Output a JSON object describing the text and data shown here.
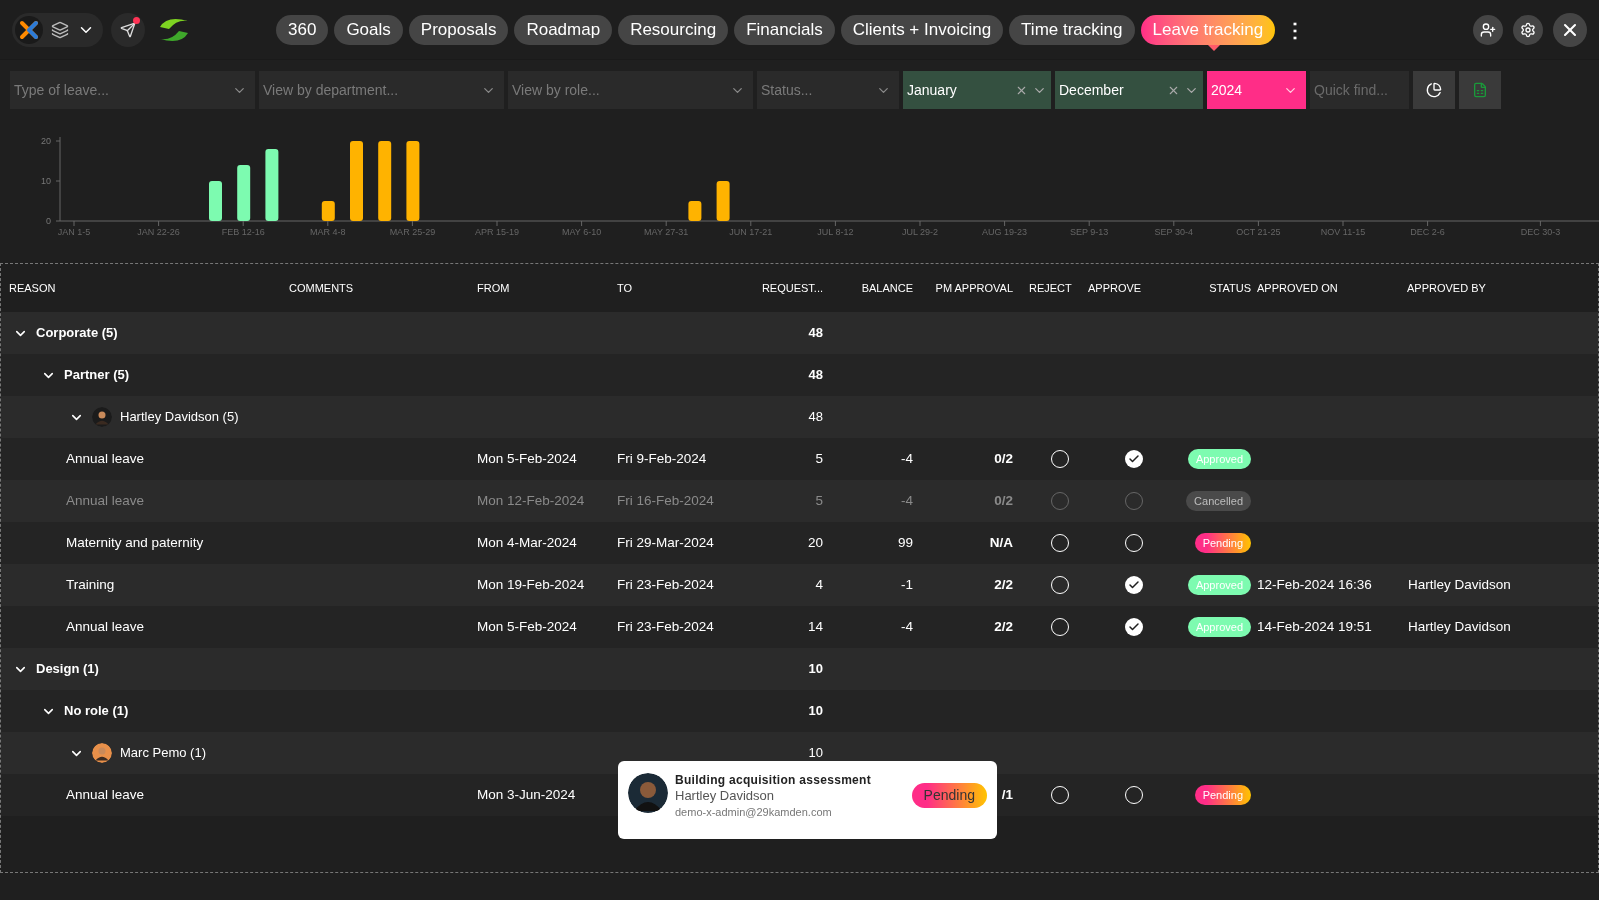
{
  "nav": {
    "tabs": [
      {
        "label": "360",
        "selected": false
      },
      {
        "label": "Goals",
        "selected": false
      },
      {
        "label": "Proposals",
        "selected": false
      },
      {
        "label": "Roadmap",
        "selected": false
      },
      {
        "label": "Resourcing",
        "selected": false
      },
      {
        "label": "Financials",
        "selected": false
      },
      {
        "label": "Clients + Invoicing",
        "selected": false
      },
      {
        "label": "Time tracking",
        "selected": false
      },
      {
        "label": "Leave tracking",
        "selected": true
      }
    ],
    "more": "⋮",
    "notification": true
  },
  "filters": [
    {
      "kind": "select",
      "placeholder": "Type of leave..."
    },
    {
      "kind": "select",
      "placeholder": "View by department..."
    },
    {
      "kind": "select",
      "placeholder": "View by role..."
    },
    {
      "kind": "select",
      "placeholder": "Status..."
    },
    {
      "kind": "range",
      "value": "January"
    },
    {
      "kind": "range",
      "value": "December"
    },
    {
      "kind": "year",
      "value": "2024"
    },
    {
      "kind": "search",
      "placeholder": "Quick find..."
    }
  ],
  "chart_data": {
    "type": "bar",
    "ylim": [
      0,
      20
    ],
    "yticks": [
      0,
      10,
      20
    ],
    "categories": [
      "JAN 1-5",
      null,
      null,
      "JAN 22-26",
      null,
      null,
      "FEB 12-16",
      null,
      null,
      "MAR 4-8",
      null,
      null,
      "MAR 25-29",
      null,
      null,
      "APR 15-19",
      null,
      null,
      "MAY 6-10",
      null,
      null,
      "MAY 27-31",
      null,
      null,
      "JUN 17-21",
      null,
      null,
      "JUL 8-12",
      null,
      null,
      "JUL 29-2",
      null,
      null,
      "AUG 19-23",
      null,
      null,
      "SEP 9-13",
      null,
      null,
      "SEP 30-4",
      null,
      null,
      "OCT 21-25",
      null,
      null,
      "NOV 11-15",
      null,
      null,
      "DEC 2-6",
      null,
      null,
      null,
      "DEC 30-3"
    ],
    "series": [
      {
        "color": "#7dfbb0",
        "values": [
          null,
          null,
          null,
          null,
          null,
          10,
          14,
          18,
          null,
          null,
          null,
          null,
          null,
          null,
          null,
          null,
          null,
          null,
          null,
          null,
          null,
          null,
          null,
          null,
          null,
          null,
          null,
          null,
          null,
          null,
          null,
          null,
          null,
          null,
          null,
          null,
          null,
          null,
          null,
          null,
          null,
          null,
          null,
          null,
          null,
          null,
          null,
          null,
          null,
          null,
          null,
          null,
          null
        ]
      },
      {
        "color": "#ffb300",
        "values": [
          null,
          null,
          null,
          null,
          null,
          null,
          null,
          null,
          null,
          5,
          20,
          20,
          20,
          null,
          null,
          null,
          null,
          null,
          null,
          null,
          null,
          null,
          5,
          10,
          null,
          null,
          null,
          null,
          null,
          null,
          null,
          null,
          null,
          null,
          null,
          null,
          null,
          null,
          null,
          null,
          null,
          null,
          null,
          null,
          null,
          null,
          null,
          null,
          null,
          null,
          null,
          null,
          null
        ]
      }
    ]
  },
  "table": {
    "columns": [
      "REASON",
      "COMMENTS",
      "FROM",
      "TO",
      "REQUEST...",
      "BALANCE",
      "PM APPROVAL",
      "REJECT",
      "APPROVE",
      "STATUS",
      "APPROVED ON",
      "APPROVED BY"
    ],
    "rows": [
      {
        "kind": "group",
        "label": "Corporate (5)",
        "total": "48",
        "expanded": true,
        "children": [
          {
            "kind": "group",
            "label": "Partner (5)",
            "total": "48",
            "expanded": true,
            "children": [
              {
                "kind": "person",
                "label": "Hartley Davidson (5)",
                "total": "48",
                "expanded": true,
                "children": [
                  {
                    "kind": "leave",
                    "reason": "Annual leave",
                    "from": "Mon 5-Feb-2024",
                    "to": "Fri 9-Feb-2024",
                    "requested": "5",
                    "balance": "-4",
                    "pm_approval": "0/2",
                    "reject": false,
                    "approve": true,
                    "status": {
                      "label": "Approved",
                      "color": "#7dfbb0",
                      "gradient": false
                    },
                    "disabled": false
                  },
                  {
                    "kind": "leave",
                    "reason": "Annual leave",
                    "from": "Mon 12-Feb-2024",
                    "to": "Fri 16-Feb-2024",
                    "requested": "5",
                    "balance": "-4",
                    "pm_approval": "0/2",
                    "reject": false,
                    "approve": false,
                    "status": {
                      "label": "Cancelled",
                      "color": "#4a4a4a",
                      "gradient": false
                    },
                    "disabled": true
                  },
                  {
                    "kind": "leave",
                    "reason": "Maternity and paternity",
                    "from": "Mon 4-Mar-2024",
                    "to": "Fri 29-Mar-2024",
                    "requested": "20",
                    "balance": "99",
                    "pm_approval": "N/A",
                    "reject": false,
                    "approve": false,
                    "status": {
                      "label": "Pending",
                      "color": "#ff2d87",
                      "gradient": true
                    },
                    "disabled": false
                  },
                  {
                    "kind": "leave",
                    "reason": "Training",
                    "from": "Mon 19-Feb-2024",
                    "to": "Fri 23-Feb-2024",
                    "requested": "4",
                    "balance": "-1",
                    "pm_approval": "2/2",
                    "reject": false,
                    "approve": true,
                    "status": {
                      "label": "Approved",
                      "color": "#7dfbb0",
                      "gradient": false
                    },
                    "approved_on": "12-Feb-2024 16:36",
                    "approved_by": "Hartley Davidson",
                    "disabled": false
                  },
                  {
                    "kind": "leave",
                    "reason": "Annual leave",
                    "from": "Mon 5-Feb-2024",
                    "to": "Fri 23-Feb-2024",
                    "requested": "14",
                    "balance": "-4",
                    "pm_approval": "2/2",
                    "reject": false,
                    "approve": true,
                    "status": {
                      "label": "Approved",
                      "color": "#7dfbb0",
                      "gradient": false
                    },
                    "approved_on": "14-Feb-2024 19:51",
                    "approved_by": "Hartley Davidson",
                    "disabled": false
                  }
                ]
              }
            ]
          }
        ]
      },
      {
        "kind": "group",
        "label": "Design (1)",
        "total": "10",
        "expanded": true,
        "children": [
          {
            "kind": "group",
            "label": "No role (1)",
            "total": "10",
            "expanded": true,
            "children": [
              {
                "kind": "person",
                "label": "Marc Pemo (1)",
                "total": "10",
                "expanded": true,
                "children": [
                  {
                    "kind": "leave",
                    "reason": "Annual leave",
                    "from": "Mon 3-Jun-2024",
                    "pm_approval": "/1",
                    "reject": false,
                    "approve": false,
                    "status": {
                      "label": "Pending",
                      "color": "#ff2d87",
                      "gradient": true
                    },
                    "disabled": false
                  }
                ]
              }
            ]
          }
        ]
      }
    ]
  },
  "popup": {
    "title": "Building acquisition assessment",
    "name": "Hartley Davidson",
    "email": "demo-x-admin@29kamden.com",
    "status": {
      "label": "Pending",
      "color": "#ff2d87",
      "gradient": true
    }
  }
}
